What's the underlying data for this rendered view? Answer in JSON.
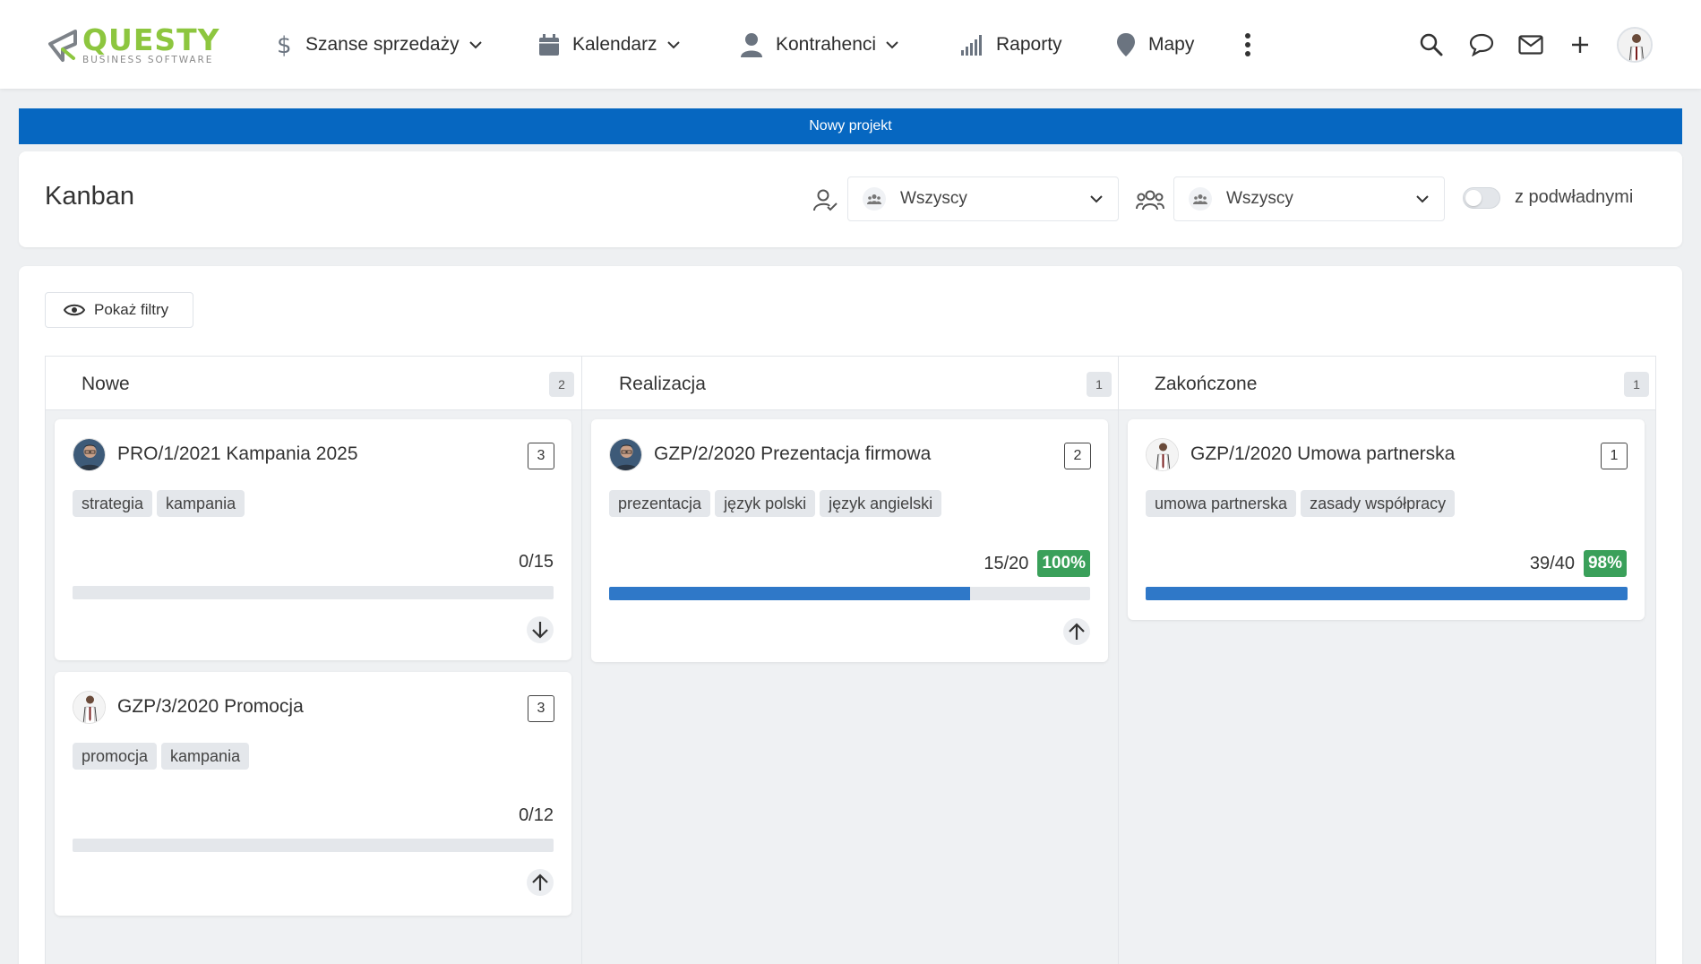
{
  "logo": {
    "name": "QUESTY",
    "subtitle": "BUSINESS SOFTWARE"
  },
  "nav": {
    "items": [
      {
        "label": "Szanse sprzedaży",
        "icon": "dollar-icon",
        "has_dropdown": true
      },
      {
        "label": "Kalendarz",
        "icon": "calendar-icon",
        "has_dropdown": true
      },
      {
        "label": "Kontrahenci",
        "icon": "user-icon",
        "has_dropdown": true
      },
      {
        "label": "Raporty",
        "icon": "bar-signal-icon",
        "has_dropdown": false
      },
      {
        "label": "Mapy",
        "icon": "map-pin-icon",
        "has_dropdown": false
      }
    ],
    "tools": [
      "more-vertical-icon",
      "search-icon",
      "chat-icon",
      "mail-icon",
      "plus-icon",
      "user-avatar"
    ]
  },
  "new_project_label": "Nowy projekt",
  "kanban": {
    "title": "Kanban",
    "owner_filter": {
      "value": "Wszyscy",
      "icon": "user-check-icon"
    },
    "team_filter": {
      "value": "Wszyscy",
      "icon": "users-icon"
    },
    "subordinates_label": "z podwładnymi",
    "subordinates_on": false
  },
  "board": {
    "show_filters_label": "Pokaż filtry",
    "columns": [
      {
        "name": "Nowe",
        "count": "2",
        "cards": [
          {
            "title": "PRO/1/2021 Kampania 2025",
            "count": "3",
            "tags": [
              "strategia",
              "kampania"
            ],
            "progress": "0/15",
            "percent": "",
            "fill": 0,
            "arrow": "down"
          },
          {
            "title": "GZP/3/2020 Promocja",
            "count": "3",
            "tags": [
              "promocja",
              "kampania"
            ],
            "progress": "0/12",
            "percent": "",
            "fill": 0,
            "arrow": "up"
          }
        ]
      },
      {
        "name": "Realizacja",
        "count": "1",
        "cards": [
          {
            "title": "GZP/2/2020 Prezentacja firmowa",
            "count": "2",
            "tags": [
              "prezentacja",
              "język polski",
              "język angielski"
            ],
            "progress": "15/20",
            "percent": "100%",
            "fill": 0.75,
            "arrow": "up"
          }
        ]
      },
      {
        "name": "Zakończone",
        "count": "1",
        "cards": [
          {
            "title": "GZP/1/2020 Umowa partnerska",
            "count": "1",
            "tags": [
              "umowa partnerska",
              "zasady współpracy"
            ],
            "progress": "39/40",
            "percent": "98%",
            "fill": 1.0,
            "arrow": ""
          }
        ]
      }
    ]
  },
  "colors": {
    "accent": "#0667c1",
    "brand": "#8dc63f",
    "progress": "#2f78c8",
    "success": "#3aa05a"
  }
}
